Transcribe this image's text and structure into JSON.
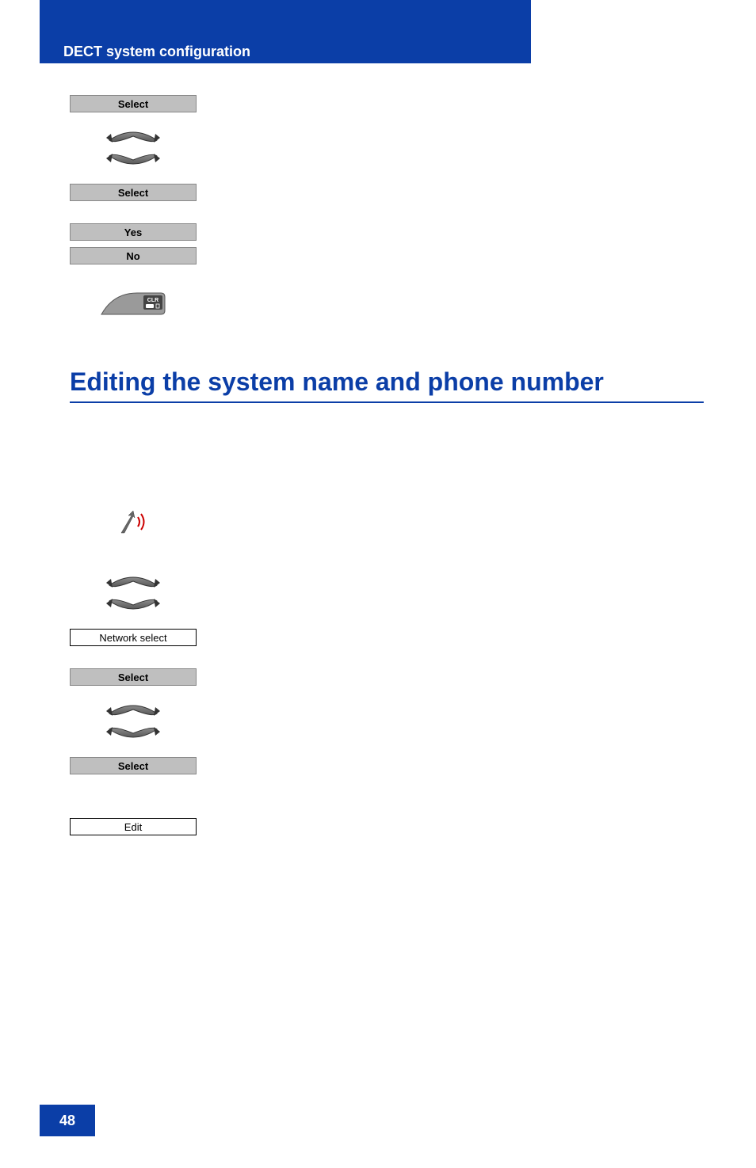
{
  "header": {
    "title": "DECT system configuration"
  },
  "steps_top": {
    "select1": "Select",
    "select2": "Select",
    "yes": "Yes",
    "no": "No"
  },
  "section": {
    "title": "Editing the system name and phone number"
  },
  "steps_bottom": {
    "network_select": "Network select",
    "select1": "Select",
    "select2": "Select",
    "edit": "Edit"
  },
  "footer": {
    "page": "48"
  }
}
